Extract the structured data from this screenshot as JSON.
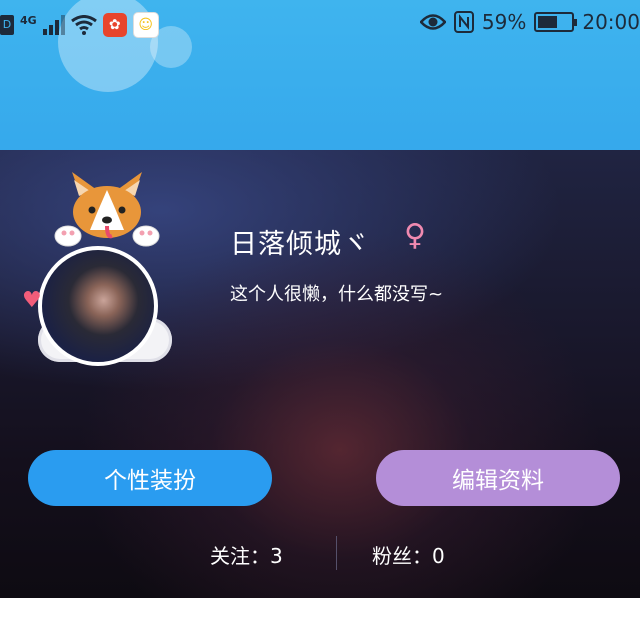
{
  "status_bar": {
    "hd_label": "D",
    "network": "4G",
    "battery_percent": "59%",
    "battery_level": 0.59,
    "time": "20:00",
    "icons": [
      "signal-icon",
      "wifi-icon",
      "app-notification-icon",
      "chat-notification-icon",
      "eye-icon",
      "nfc-icon",
      "battery-icon"
    ]
  },
  "profile": {
    "username": "日落倾城ヾ",
    "gender_symbol": "♀",
    "bio": "这个人很懒，什么都没写~"
  },
  "buttons": {
    "dress_up": "个性装扮",
    "edit_profile": "编辑资料"
  },
  "stats": {
    "follow": "关注：3",
    "fans": "粉丝：0"
  },
  "colors": {
    "header": "#3fb4ee",
    "dress_button": "#2a9cf0",
    "edit_button": "#b48ed8",
    "gender": "#f08ab0"
  }
}
